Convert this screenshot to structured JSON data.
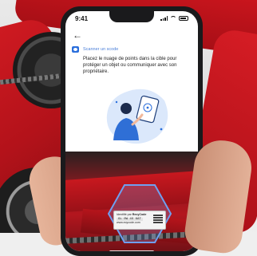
{
  "status_bar": {
    "time": "9:41"
  },
  "nav": {
    "back_icon": "arrow-left-icon"
  },
  "scan_section": {
    "title": "Scanner un scode",
    "icon": "scan-icon",
    "instructions": "Placez le nuage de points dans la cible pour protéger un objet ou communiquer avec son propriétaire."
  },
  "sticker": {
    "line1": "Identifié par",
    "brand": "RecyCode",
    "code": "GL 0W 4X 6AT",
    "line3": "www.ecycode.com"
  },
  "colors": {
    "accent": "#2b6fdc",
    "bike_red": "#c8181f",
    "phone_body": "#1a1a1c"
  }
}
